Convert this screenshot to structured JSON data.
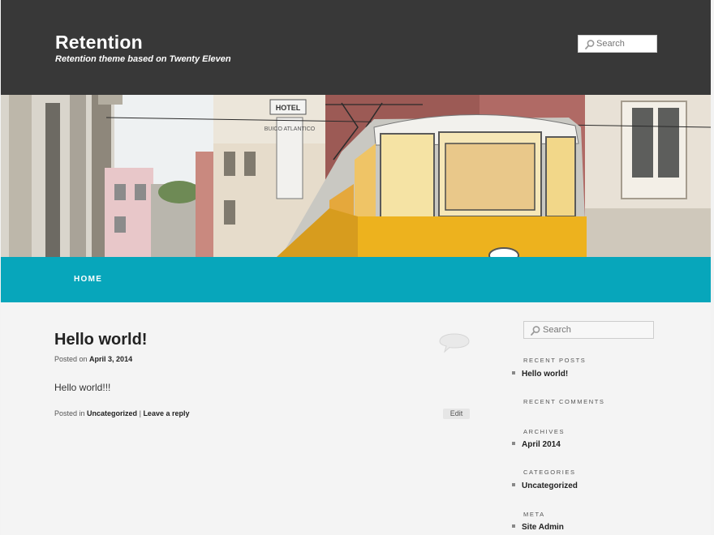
{
  "header": {
    "site_title": "Retention",
    "site_description": "Retention theme based on Twenty Eleven",
    "search_placeholder": "Search",
    "background_color": "#383838"
  },
  "banner": {
    "hotel_sign": "HOTEL",
    "vertical_sign": "BUICO ATLANTICO"
  },
  "nav": {
    "items": [
      {
        "label": "HOME"
      }
    ],
    "background_color": "#07a6bb"
  },
  "post": {
    "title": "Hello world!",
    "posted_on_label": "Posted on",
    "date": "April 3, 2014",
    "body": "Hello world!!!",
    "posted_in_label": "Posted in",
    "category": "Uncategorized",
    "separator": "|",
    "reply_link": "Leave a reply",
    "edit_label": "Edit",
    "comment_icon": "comment-bubble-icon"
  },
  "sidebar": {
    "search_placeholder": "Search",
    "widgets": [
      {
        "heading": "RECENT POSTS",
        "items": [
          "Hello world!"
        ]
      },
      {
        "heading": "RECENT COMMENTS",
        "items": []
      },
      {
        "heading": "ARCHIVES",
        "items": [
          "April 2014"
        ]
      },
      {
        "heading": "CATEGORIES",
        "items": [
          "Uncategorized"
        ]
      },
      {
        "heading": "META",
        "items": [
          "Site Admin"
        ]
      }
    ]
  }
}
